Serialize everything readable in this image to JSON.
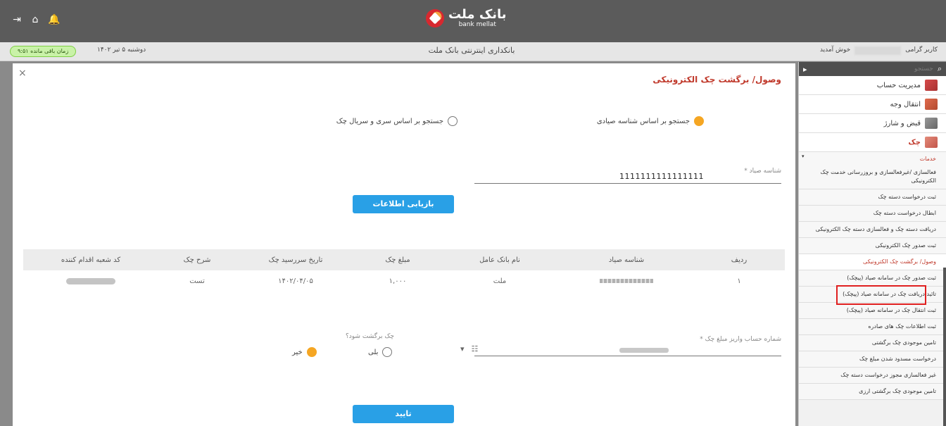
{
  "header": {
    "logo_fa": "بانک ملت",
    "logo_en": "bank mellat",
    "icons": [
      "logout-icon",
      "home-icon",
      "bell-icon"
    ]
  },
  "subbar": {
    "timer": "زمان باقی مانده ۹:۵۱",
    "date": "دوشنبه ۵ تیر ۱۴۰۲",
    "bank_title": "بانکداری اینترنتی بانک ملت",
    "greeting_prefix": "کاربر گرامی",
    "greeting_suffix": "خوش آمدید"
  },
  "panel": {
    "title": "وصول/ برگشت چک الکترونیکی",
    "close": "×",
    "search_by_sayad": "جستجو بر اساس شناسه صیادی",
    "search_by_serial": "جستجو بر اساس سری و سریال چک",
    "sayad_label": "شناسه صیاد *",
    "sayad_value": "1111111111111111",
    "retrieve_button": "بازیابی اطلاعات",
    "table": {
      "headers": [
        "ردیف",
        "شناسه صیاد",
        "نام بانک عامل",
        "مبلغ چک",
        "تاریخ سررسید چک",
        "شرح چک",
        "کد شعبه اقدام کننده"
      ],
      "rows": [
        [
          "۱",
          "",
          "ملت",
          "۱,۰۰۰",
          "۱۴۰۲/۰۴/۰۵",
          "تست",
          ""
        ]
      ]
    },
    "deposit_label": "شماره حساب واریز مبلغ چک *",
    "bounce_question": "چک برگشت شود؟",
    "yes": "بلی",
    "no": "خیر",
    "confirm_button": "تایید"
  },
  "sidebar": {
    "search_placeholder": "جستجو",
    "main_items": [
      {
        "label": "مدیریت حساب",
        "icon": "account-icon"
      },
      {
        "label": "انتقال وجه",
        "icon": "transfer-icon"
      },
      {
        "label": "قبض و شارژ",
        "icon": "bill-icon"
      },
      {
        "label": "چک",
        "icon": "cheque-icon"
      }
    ],
    "services_title": "خدمات",
    "services": [
      "فعالسازی /غیرفعالسازی و بروزرسانی خدمت چک الکترونیکی",
      "ثبت درخواست دسته چک",
      "ابطال درخواست دسته چک",
      "دریافت دسته چک و فعالسازی دسته چک الکترونیکی",
      "ثبت صدور چک الکترونیکی",
      "وصول/ برگشت چک الکترونیکی",
      "ثبت صدور چک در سامانه صیاد (پیچک)",
      "تائید دریافت چک در سامانه صیاد (پیچک)",
      "ثبت انتقال چک در سامانه صیاد (پیچک)",
      "ثبت اطلاعات چک های صادره",
      "تامین موجودی چک برگشتی",
      "درخواست مسدود شدن مبلغ چک",
      "غیر فعالسازی مجوز درخواست دسته چک",
      "تامین موجودی چک برگشتی ارزی"
    ]
  }
}
